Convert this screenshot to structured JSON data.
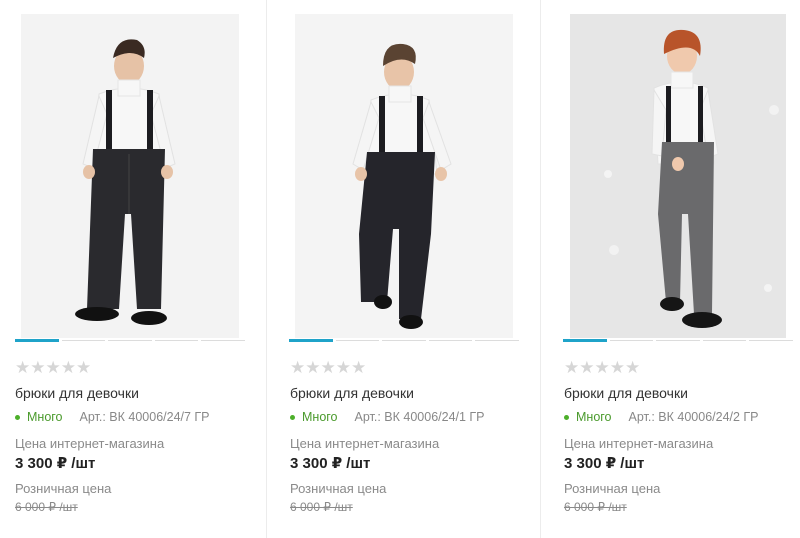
{
  "products": [
    {
      "rating_stars": "★★★★★",
      "name": "брюки для девочки",
      "stock_label": "Много",
      "article": "Арт.: ВК 40006/24/7 ГР",
      "online_price_label": "Цена интернет-магазина",
      "price": "3 300 ₽ /шт",
      "retail_price_label": "Розничная цена",
      "old_price": "6 000 ₽ /шт",
      "image_alt": "boy in black winter overalls",
      "pants_color": "#2a2a2e",
      "slides": 5,
      "active_slide": 1
    },
    {
      "rating_stars": "★★★★★",
      "name": "брюки для девочки",
      "stock_label": "Много",
      "article": "Арт.: ВК 40006/24/1 ГР",
      "online_price_label": "Цена интернет-магазина",
      "price": "3 300 ₽ /шт",
      "retail_price_label": "Розничная цена",
      "old_price": "6 000 ₽ /шт",
      "image_alt": "boy in black winter overalls",
      "pants_color": "#25252b",
      "slides": 5,
      "active_slide": 1
    },
    {
      "rating_stars": "★★★★★",
      "name": "брюки для девочки",
      "stock_label": "Много",
      "article": "Арт.: ВК 40006/24/2 ГР",
      "online_price_label": "Цена интернет-магазина",
      "price": "3 300 ₽ /шт",
      "retail_price_label": "Розничная цена",
      "old_price": "6 000 ₽ /шт",
      "image_alt": "boy in grey winter overalls",
      "pants_color": "#6a6a6c",
      "slides": 5,
      "active_slide": 1
    }
  ],
  "colors": {
    "accent": "#1fa3c9",
    "in_stock": "#4caf2a",
    "star_empty": "#d6d6d6"
  }
}
